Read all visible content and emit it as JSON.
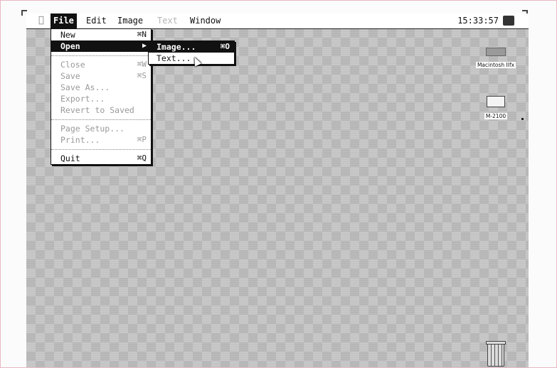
{
  "menubar": {
    "apple_icon": "apple-menu-icon",
    "menus": [
      {
        "label": "File",
        "state": "active"
      },
      {
        "label": "Edit",
        "state": "enabled"
      },
      {
        "label": "Image",
        "state": "enabled"
      },
      {
        "label": "Text",
        "state": "disabled"
      },
      {
        "label": "Window",
        "state": "enabled"
      }
    ],
    "clock": "15:33:57",
    "finder_icon": "finder-app-icon"
  },
  "file_menu": {
    "items": [
      {
        "label": "New",
        "shortcut": "⌘N",
        "enabled": true
      },
      {
        "label": "Open",
        "shortcut": "▶",
        "enabled": true,
        "highlighted": true,
        "has_submenu": true
      },
      {
        "label": "Close",
        "shortcut": "⌘W",
        "enabled": false
      },
      {
        "label": "Save",
        "shortcut": "⌘S",
        "enabled": false
      },
      {
        "label": "Save As...",
        "shortcut": "",
        "enabled": false
      },
      {
        "label": "Export...",
        "shortcut": "",
        "enabled": false
      },
      {
        "label": "Revert to Saved",
        "shortcut": "",
        "enabled": false
      },
      {
        "label": "Page Setup...",
        "shortcut": "",
        "enabled": false
      },
      {
        "label": "Print...",
        "shortcut": "⌘P",
        "enabled": false
      },
      {
        "label": "Quit",
        "shortcut": "⌘Q",
        "enabled": true
      }
    ]
  },
  "open_submenu": {
    "items": [
      {
        "label": "Image...",
        "shortcut": "⌘O",
        "highlighted": true
      },
      {
        "label": "Text...",
        "shortcut": ""
      }
    ]
  },
  "desktop": {
    "icons": [
      {
        "label": "Macintosh IIfx",
        "icon": "hard-disk-icon"
      },
      {
        "label": "M-2100",
        "icon": "printer-disk-icon"
      },
      {
        "label": "",
        "icon": "trash-icon"
      }
    ]
  },
  "colors": {
    "menu_highlight": "#111111",
    "menu_disabled": "#9a9a9a",
    "desktop_pattern": "#c4c4c4"
  }
}
